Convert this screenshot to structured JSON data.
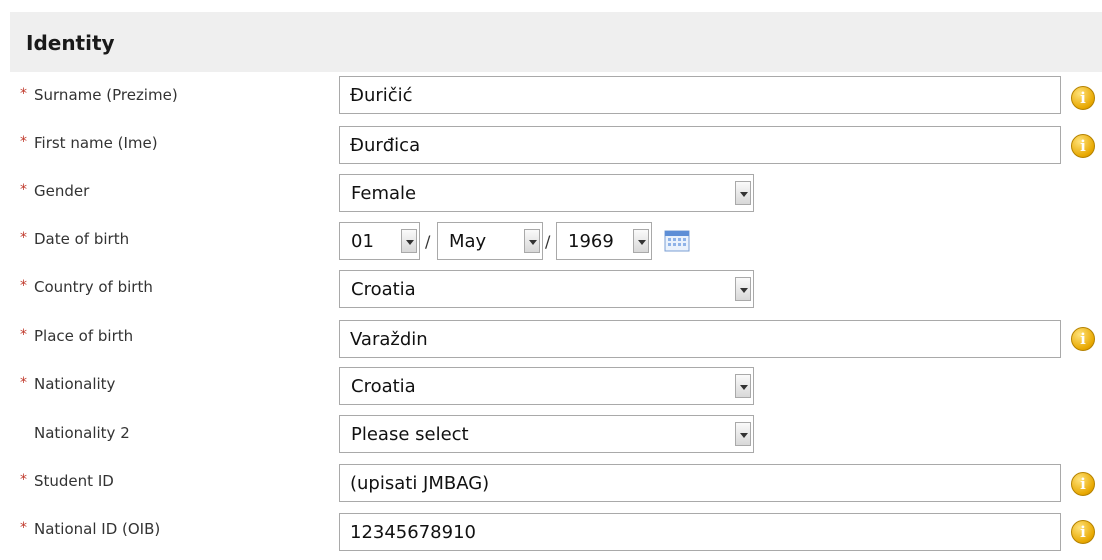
{
  "section": {
    "title": "Identity"
  },
  "required_marker": "*",
  "fields": {
    "surname": {
      "label": "Surname (Prezime)",
      "value": "Đuričić",
      "required": true,
      "info": true
    },
    "first_name": {
      "label": "First name (Ime)",
      "value": "Đurđica",
      "required": true,
      "info": true
    },
    "gender": {
      "label": "Gender",
      "value": "Female",
      "required": true
    },
    "dob": {
      "label": "Date of birth",
      "day": "01",
      "month": "May",
      "year": "1969",
      "separator": "/",
      "required": true
    },
    "country_of_birth": {
      "label": "Country of birth",
      "value": "Croatia",
      "required": true
    },
    "place_of_birth": {
      "label": "Place of birth",
      "value": "Varaždin",
      "required": true,
      "info": true
    },
    "nationality": {
      "label": "Nationality",
      "value": "Croatia",
      "required": true
    },
    "nationality2": {
      "label": "Nationality 2",
      "value": "Please select",
      "required": false
    },
    "student_id": {
      "label": "Student ID",
      "value": "(upisati JMBAG)",
      "required": true,
      "info": true
    },
    "national_id": {
      "label": "National ID (OIB)",
      "value": "12345678910",
      "required": true,
      "info": true
    }
  },
  "icons": {
    "info": "info-icon",
    "calendar": "calendar-icon",
    "dropdown": "chevron-down-icon"
  },
  "info_glyph": "i",
  "colors": {
    "header_bg": "#efefef",
    "required": "#c0392b",
    "info": "#e8a800"
  }
}
